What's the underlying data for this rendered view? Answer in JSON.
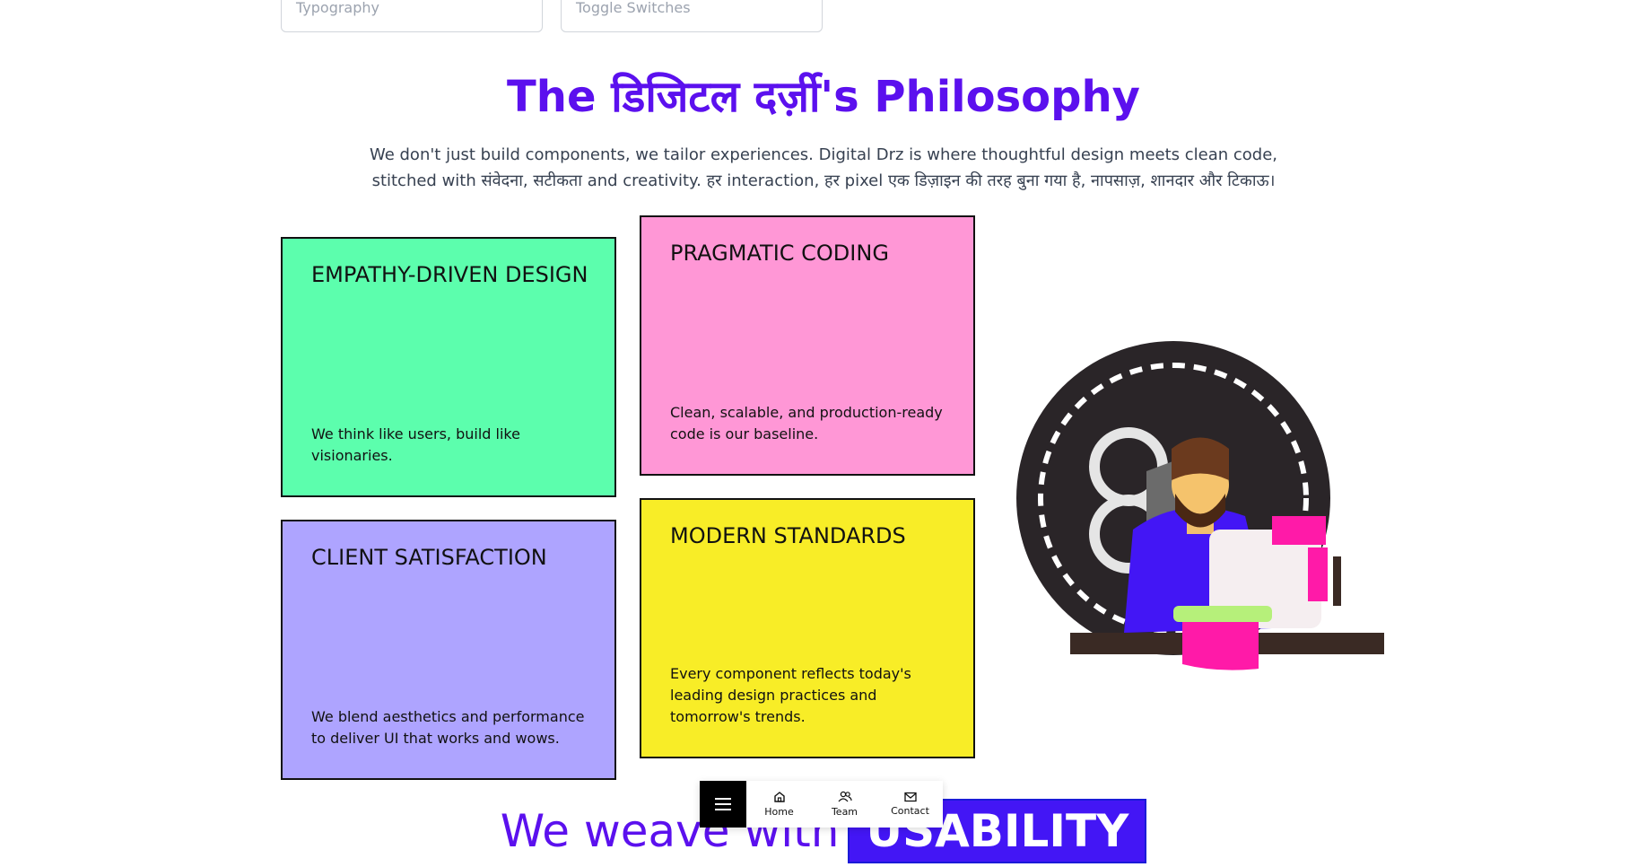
{
  "top_cards": [
    "Typography",
    "Toggle Switches"
  ],
  "philosophy": {
    "title": "The डिजिटल दर्ज़ी's Philosophy",
    "intro": "We don't just build components, we tailor experiences. Digital Drz is where thoughtful design meets clean code, stitched with संवेदना, सटीकता and creativity. हर interaction, हर pixel एक डिज़ाइन की तरह बुना गया है, नापसाज़, शानदार और टिकाऊ।"
  },
  "cards": [
    {
      "title": "EMPATHY-DRIVEN DESIGN",
      "text": "We think like users, build like visionaries.",
      "color": "#5cfead"
    },
    {
      "title": "PRAGMATIC CODING",
      "text": "Clean, scalable, and production-ready code is our baseline.",
      "color": "#ff97d6"
    },
    {
      "title": "CLIENT SATISFACTION",
      "text": "We blend aesthetics and performance to deliver UI that works and wows.",
      "color": "#aea4ff"
    },
    {
      "title": "MODERN STANDARDS",
      "text": "Every component reflects today's leading design practices and tomorrow's trends.",
      "color": "#f8ed27"
    }
  ],
  "weave": {
    "prefix": "We weave with",
    "highlight": "USABILITY"
  },
  "nav": {
    "menu_icon": "hamburger-icon",
    "items": [
      {
        "label": "Home",
        "icon": "home-icon"
      },
      {
        "label": "Team",
        "icon": "users-icon"
      },
      {
        "label": "Contact",
        "icon": "mail-icon"
      }
    ]
  },
  "colors": {
    "accent": "#5b10ee",
    "highlight_bg": "#4316f5"
  }
}
